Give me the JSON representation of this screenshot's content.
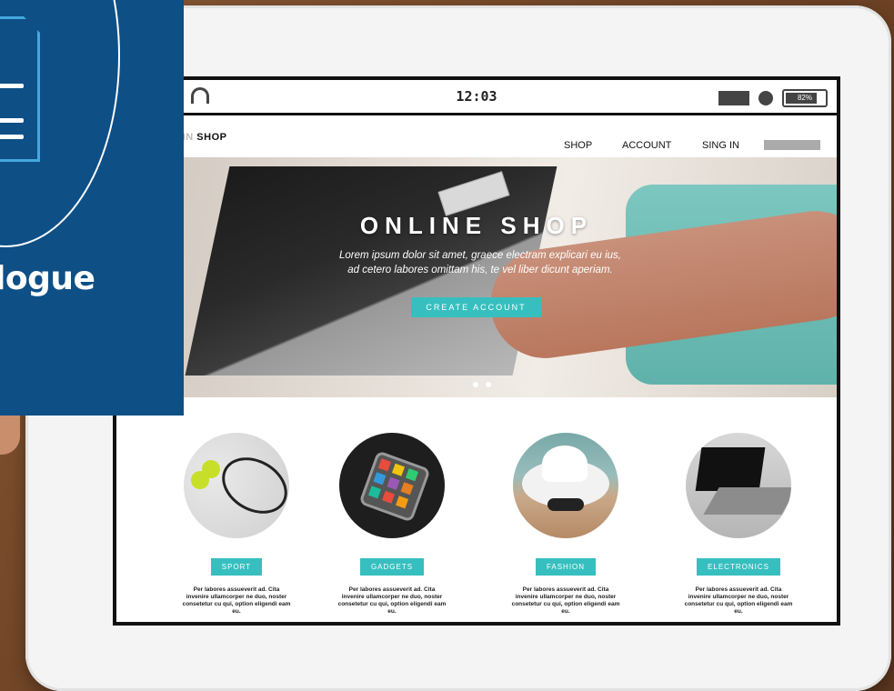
{
  "overlay": {
    "text": "logue"
  },
  "statusbar": {
    "time": "12:03",
    "battery": "82%",
    "battery_level": 0.82
  },
  "nav": {
    "brand_faded": "ONLIN",
    "brand": "SHOP",
    "links": [
      "SHOP",
      "ACCOUNT",
      "SING IN"
    ]
  },
  "hero": {
    "title": "ONLINE SHOP",
    "subtitle_1": "Lorem ipsum dolor sit amet, graece electram explicari eu ius,",
    "subtitle_2": "ad cetero labores omittam his, te vel liber dicunt aperiam.",
    "button": "CREATE ACCOUNT"
  },
  "categories": [
    {
      "label": "SPORT",
      "desc": "Per labores assueverit ad. Cita invenire ullamcorper ne duo, noster consetetur cu qui, option eligendi eam eu."
    },
    {
      "label": "GADGETS",
      "desc": "Per labores assueverit ad. Cita invenire ullamcorper ne duo, noster consetetur cu qui, option eligendi eam eu."
    },
    {
      "label": "FASHION",
      "desc": "Per labores assueverit ad. Cita invenire ullamcorper ne duo, noster consetetur cu qui, option eligendi eam eu."
    },
    {
      "label": "ELECTRONICS",
      "desc": "Per labores assueverit ad. Cita invenire ullamcorper ne duo, noster consetetur cu qui, option eligendi eam eu."
    }
  ],
  "colors": {
    "accent": "#37bfbf",
    "overlay": "#0e4f86",
    "overlay_icon": "#46a7e0"
  },
  "icons": [
    "signal-icon",
    "headphones-icon",
    "mail-icon",
    "circle-icon",
    "battery-icon",
    "document-icon"
  ]
}
